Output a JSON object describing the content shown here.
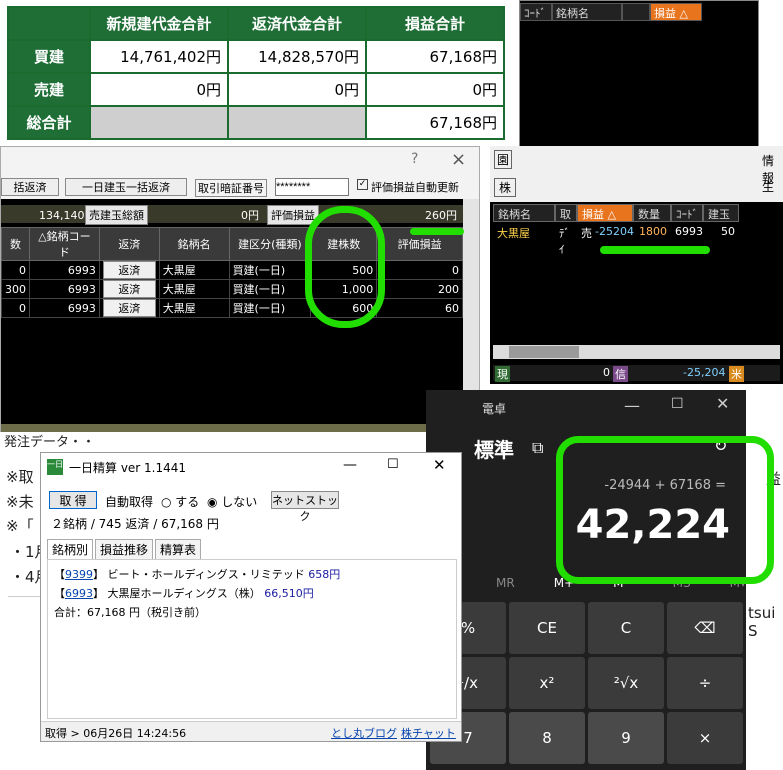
{
  "summary": {
    "headers": [
      "",
      "新規建代金合計",
      "返済代金合計",
      "損益合計"
    ],
    "rows": [
      {
        "label": "買建",
        "new": "14,761,402円",
        "repay": "14,828,570円",
        "pl": "67,168円"
      },
      {
        "label": "売建",
        "new": "0円",
        "repay": "0円",
        "pl": "0円"
      },
      {
        "label": "総合計",
        "new": "",
        "repay": "",
        "pl": "67,168円"
      }
    ]
  },
  "monitor": {
    "headers": [
      "ｺｰﾄﾞ",
      "銘柄名",
      "",
      "損益 △"
    ]
  },
  "grid": {
    "dialog_question": "?",
    "dialog_close": "×",
    "toolbar_btn1": "括返済",
    "toolbar_btn2": "一日建玉一括返済",
    "pin_label": "取引暗証番号",
    "pin_value": "********",
    "auto_update_label": "評価損益自動更新",
    "total_left": "134,140円",
    "total_label": "売建玉総額",
    "total_value": "0円",
    "eval_label": "評価損益",
    "eval_value": "260円",
    "columns": [
      "数",
      "△銘柄コード",
      "返済",
      "銘柄名",
      "建区分(種類)",
      "建株数",
      "評価損益"
    ],
    "rows": [
      {
        "n": "0",
        "code": "6993",
        "ret": "返済",
        "name": "大黒屋",
        "type": "買建(一日)",
        "qty": "500",
        "pl": "0"
      },
      {
        "n": "300",
        "code": "6993",
        "ret": "返済",
        "name": "大黒屋",
        "type": "買建(一日)",
        "qty": "1,000",
        "pl": "200"
      },
      {
        "n": "0",
        "code": "6993",
        "ret": "返済",
        "name": "大黒屋",
        "type": "買建(一日)",
        "qty": "600",
        "pl": "60"
      }
    ]
  },
  "rpanel": {
    "tab_char": "園",
    "info_label": "情報",
    "side_label": "株",
    "side_label2": "生",
    "columns": [
      "銘柄名",
      "取",
      "損益 △",
      "数量",
      "ｺｰﾄﾞ",
      "建玉"
    ],
    "row": {
      "name": "大黒屋",
      "kind": "ﾃﾞｲ",
      "side": "売",
      "pl": "-25204",
      "qty": "1800",
      "code": "6993",
      "pos": "50"
    },
    "footer_left": "現",
    "footer_zero": "0",
    "footer_shin": "信",
    "footer_val": "-25,204",
    "footer_rice": "米",
    "right_partial": "損益"
  },
  "calc": {
    "title_partial": "電卓",
    "mode": "標準",
    "expression": "-24944 + 67168 =",
    "display": "42,224",
    "memory": [
      "MR",
      "M+",
      "M−",
      "MS",
      "M▾"
    ],
    "keys": [
      "%",
      "CE",
      "C",
      "⌫",
      "¹/x",
      "x²",
      "²√x",
      "÷",
      "7",
      "8",
      "9",
      "×"
    ]
  },
  "page": {
    "lines": [
      "※取",
      "※未",
      "※「",
      "・1月",
      "・4月"
    ],
    "partial_top": "発注データ・・",
    "right_partial": "tsui S",
    "right_char": "益"
  },
  "ichi": {
    "title": "一日精算 ver 1.1441",
    "get_button": "取 得",
    "auto_label": "自動取得",
    "opt_yes": "する",
    "opt_no": "しない",
    "netstock_button": "ネットストック",
    "summary": "２銘柄 / 745 返済 / 67,168 円",
    "tabs": [
      "銘柄別",
      "損益推移",
      "精算表"
    ],
    "items": [
      {
        "code": "9399",
        "name": "ビート・ホールディングス・リミテッド",
        "amount": "658円"
      },
      {
        "code": "6993",
        "name": "大黒屋ホールディングス（株）",
        "amount": "66,510円"
      }
    ],
    "total": "合計：67,168 円（税引き前）",
    "status": "取得 > 06月26日 14:24:56",
    "link1": "とし丸ブログ",
    "link2": "株チャット"
  }
}
